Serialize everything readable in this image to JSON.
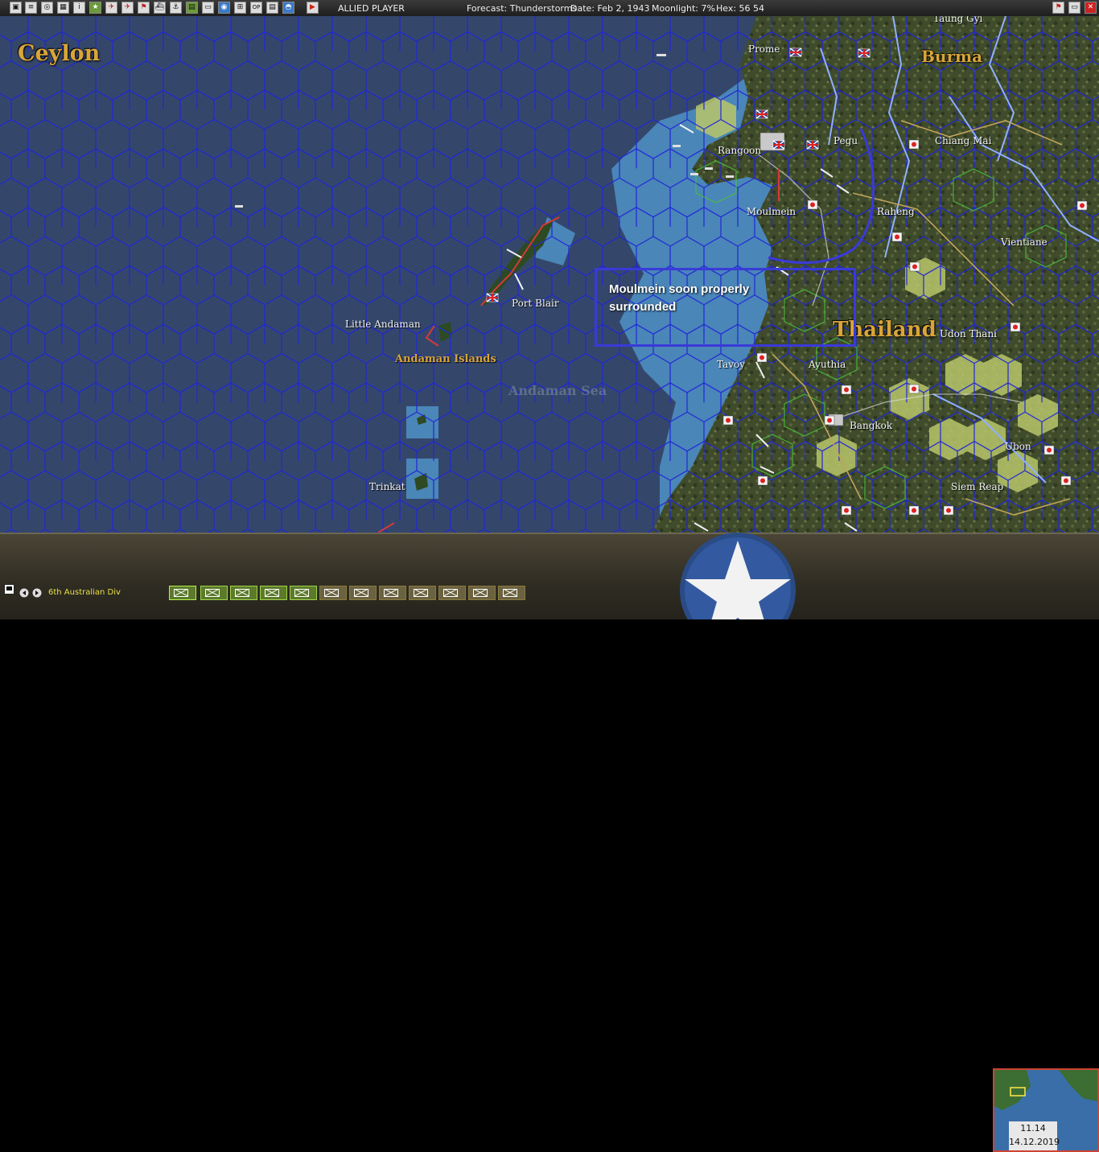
{
  "toolbar": {
    "player": "ALLIED PLAYER",
    "forecast": "Forecast: Thunderstorms",
    "date": "Date: Feb 2, 1943",
    "moonlight": "Moonlight: 7%",
    "hex": "Hex: 56 54"
  },
  "map": {
    "regions": {
      "ceylon": "Ceylon",
      "burma": "Burma",
      "thailand": "Thailand"
    },
    "places": {
      "prome": "Prome",
      "rangoon": "Rangoon",
      "pegu": "Pegu",
      "moulmein": "Moulmein",
      "chiang_mai": "Chiang Mai",
      "raheng": "Raheng",
      "vientiane": "Vientiane",
      "taung_gyi": "Taung Gyi",
      "port_blair": "Port Blair",
      "little_andaman": "Little Andaman",
      "andaman_islands": "Andaman Islands",
      "andaman_sea": "Andaman Sea",
      "tavoy": "Tavoy",
      "ayuthia": "Ayuthia",
      "udon_thani": "Udon Thani",
      "bangkok": "Bangkok",
      "ubon": "Ubon",
      "siem_reap": "Siem Reap",
      "trinkat": "Trinkat"
    },
    "annotation": "Moulmein soon properly surrounded"
  },
  "bottom": {
    "unit_name": "6th Australian Div",
    "minimap_time": "11.14",
    "minimap_date": "14.12.2019"
  },
  "colors": {
    "deep_sea": "#34476b",
    "shallow_sea": "#4a86b8",
    "hex_line": "#1f25d8",
    "land": "#3d4a2a",
    "annotation": "#3a3ad8",
    "region_label": "#d9a53a"
  }
}
